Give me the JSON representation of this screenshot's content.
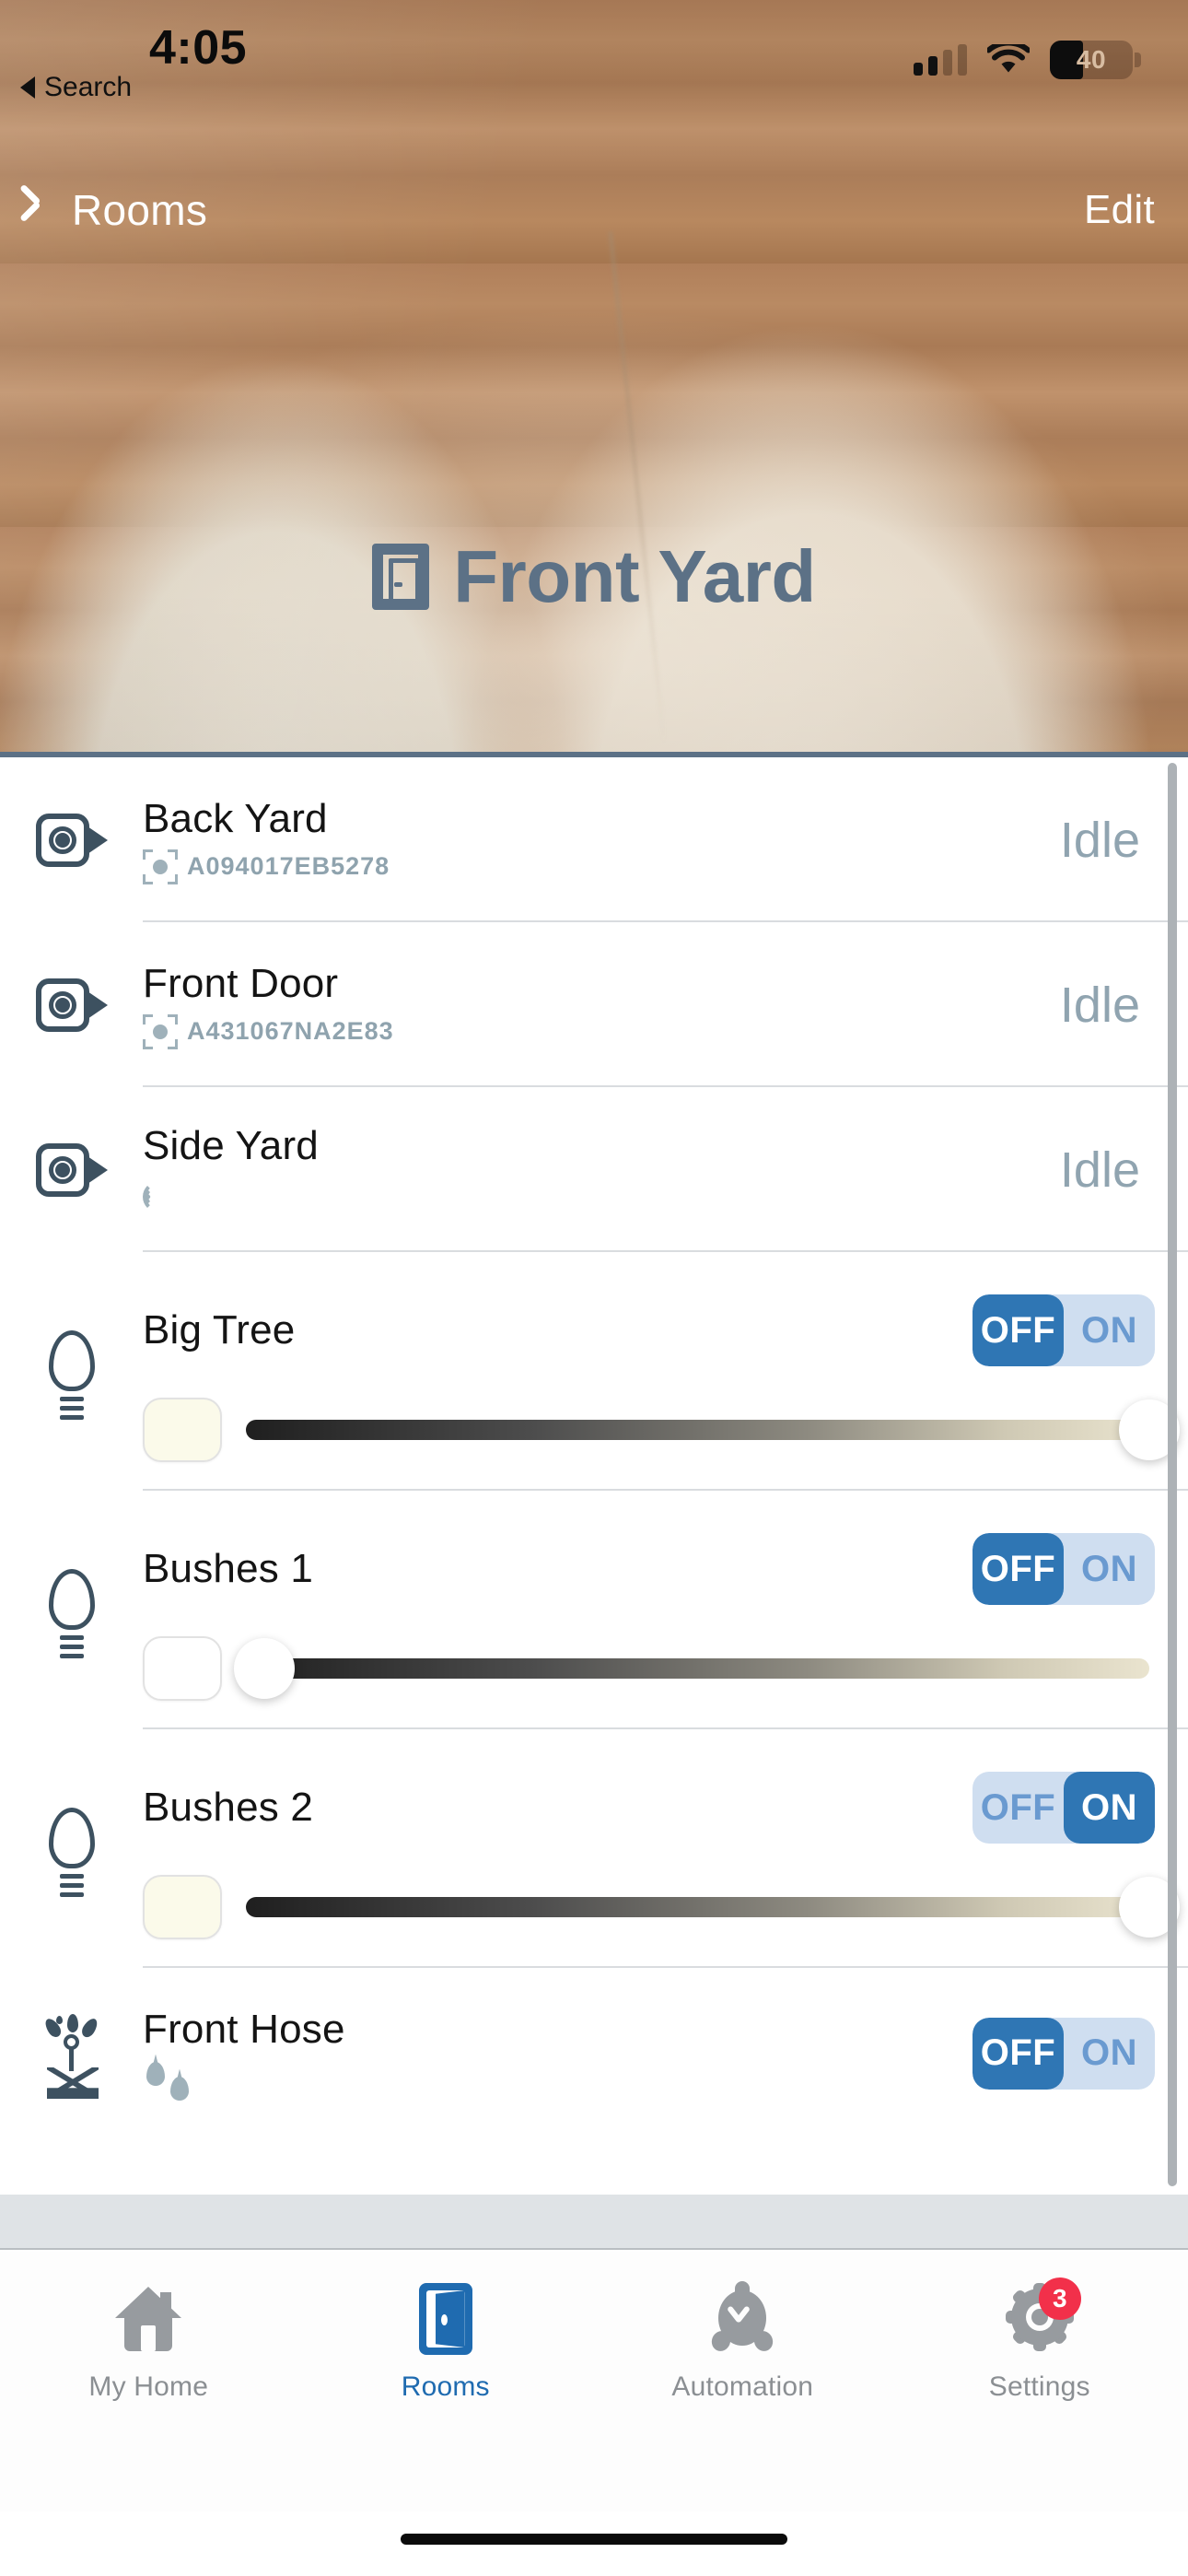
{
  "status_bar": {
    "time": "4:05",
    "back_to_app": "Search",
    "battery_percent": "40",
    "signal_bars_filled": 2,
    "signal_bars_total": 4,
    "wifi_icon": "wifi-icon",
    "battery_icon": "battery-icon"
  },
  "nav": {
    "back_label": "Rooms",
    "back_icon": "chevron-left-icon",
    "edit_label": "Edit"
  },
  "hero": {
    "title": "Front Yard",
    "title_icon": "door-icon",
    "title_color": "#5c7186"
  },
  "colors": {
    "accent_blue": "#2f76b4",
    "toggle_track": "#cfdef0",
    "toggle_inactive_text": "#6a9ad0",
    "status_text": "#90a4b0",
    "device_icon": "#3d5160",
    "badge_red": "#f2304a",
    "tab_active": "#1f6bb0",
    "tab_inactive": "#979b9f"
  },
  "devices": [
    {
      "type": "camera",
      "name": "Back Yard",
      "icon": "camera-icon",
      "sub_icon": "motion-sensor-icon",
      "device_id": "A094017EB5278",
      "status": "Idle"
    },
    {
      "type": "camera",
      "name": "Front Door",
      "icon": "camera-icon",
      "sub_icon": "motion-sensor-icon",
      "device_id": "A431067NA2E83",
      "status": "Idle"
    },
    {
      "type": "camera",
      "name": "Side Yard",
      "icon": "camera-icon",
      "sub_icon": "signal-wave-icon",
      "device_id": "",
      "status": "Idle"
    },
    {
      "type": "light",
      "name": "Big Tree",
      "icon": "lightbulb-icon",
      "toggle": {
        "off_label": "OFF",
        "on_label": "ON",
        "state": "off"
      },
      "color_swatch": "#fbfaea",
      "brightness_percent": 100
    },
    {
      "type": "light",
      "name": "Bushes 1",
      "icon": "lightbulb-icon",
      "toggle": {
        "off_label": "OFF",
        "on_label": "ON",
        "state": "off"
      },
      "color_swatch": "#ffffff",
      "brightness_percent": 2
    },
    {
      "type": "light",
      "name": "Bushes 2",
      "icon": "lightbulb-icon",
      "toggle": {
        "off_label": "OFF",
        "on_label": "ON",
        "state": "on"
      },
      "color_swatch": "#fbfaea",
      "brightness_percent": 100
    },
    {
      "type": "sprinkler",
      "name": "Front Hose",
      "icon": "sprinkler-icon",
      "sub_icon": "water-drops-icon",
      "toggle": {
        "off_label": "OFF",
        "on_label": "ON",
        "state": "off"
      }
    }
  ],
  "tabs": [
    {
      "label": "My Home",
      "icon": "house-icon",
      "active": false,
      "badge": ""
    },
    {
      "label": "Rooms",
      "icon": "door-icon",
      "active": true,
      "badge": ""
    },
    {
      "label": "Automation",
      "icon": "automation-icon",
      "active": false,
      "badge": ""
    },
    {
      "label": "Settings",
      "icon": "gear-icon",
      "active": false,
      "badge": "3"
    }
  ]
}
